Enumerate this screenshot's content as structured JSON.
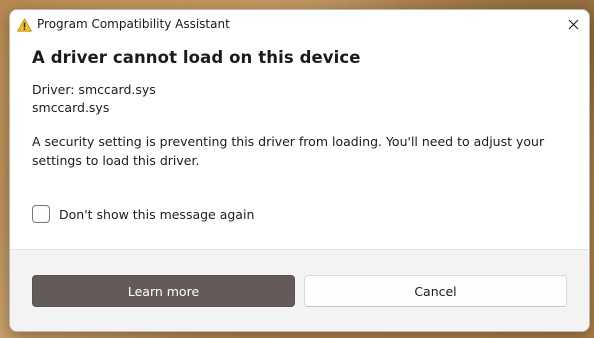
{
  "window": {
    "title": "Program Compatibility Assistant",
    "title_icon": "warning-triangle-icon",
    "close_icon": "close-icon"
  },
  "dialog": {
    "heading": "A driver cannot load on this device",
    "driver_line": "Driver: smccard.sys",
    "filename_line": "smccard.sys",
    "message": "A security setting is preventing this driver from loading. You'll need to adjust your settings to load this driver."
  },
  "checkbox": {
    "label": "Don't show this message again",
    "checked": false
  },
  "buttons": {
    "learn_more": "Learn more",
    "cancel": "Cancel"
  },
  "colors": {
    "primary_button": "#625b59",
    "warning_yellow": "#f2c318",
    "footer_bg": "#f3f3f3"
  }
}
